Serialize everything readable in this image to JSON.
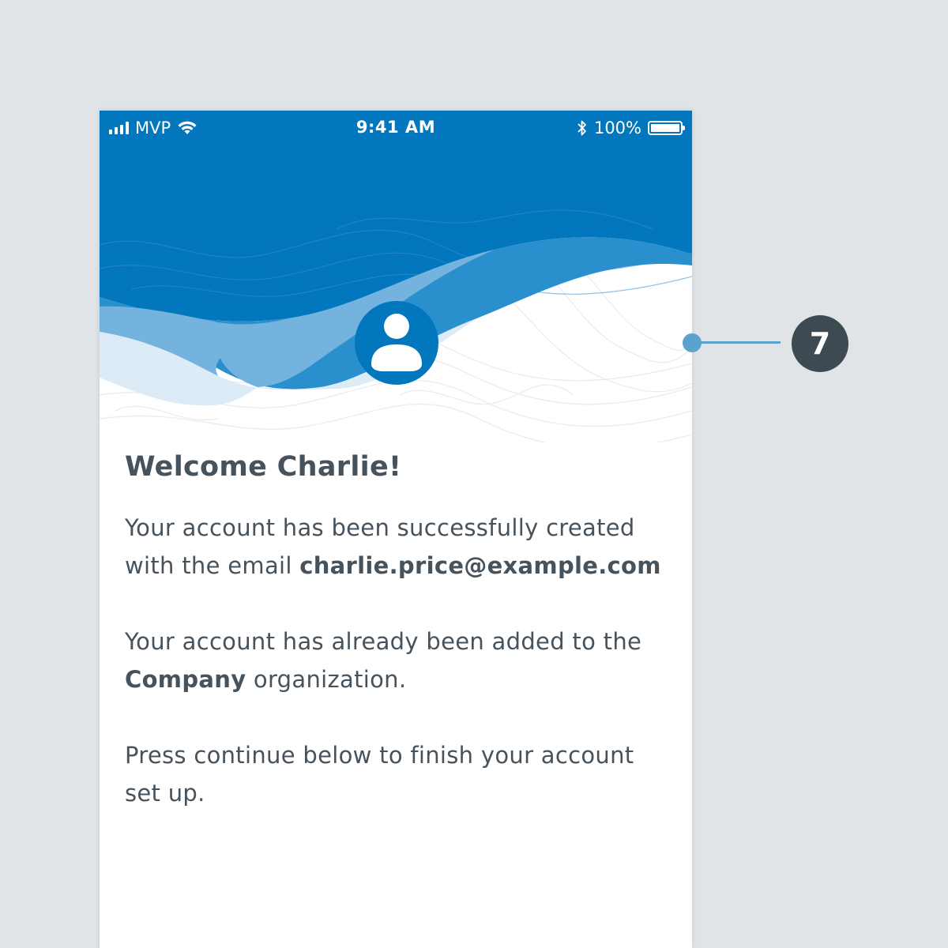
{
  "status_bar": {
    "carrier": "MVP",
    "time": "9:41 AM",
    "battery_percent": "100%",
    "battery_level": 1.0,
    "icons": [
      "signal-icon",
      "wifi-icon",
      "bluetooth-icon",
      "battery-icon"
    ]
  },
  "header": {
    "avatar_icon": "user-icon",
    "colors": {
      "primary": "#0277bd",
      "wave_mid": "#2a8fcd",
      "wave_light": "#74b3de",
      "wave_pale": "#d6e8f5"
    }
  },
  "welcome": {
    "title": "Welcome Charlie!",
    "p1_text": "Your account has been successfully created with the email ",
    "p1_email": "charlie.price@example.com",
    "p2_text": "Your account has already been added to the ",
    "p2_org": "Company",
    "p2_suffix": " organization.",
    "p3_text": "Press continue below to finish your account set up."
  },
  "annotation": {
    "number": "7",
    "color": "#3e4a52"
  }
}
